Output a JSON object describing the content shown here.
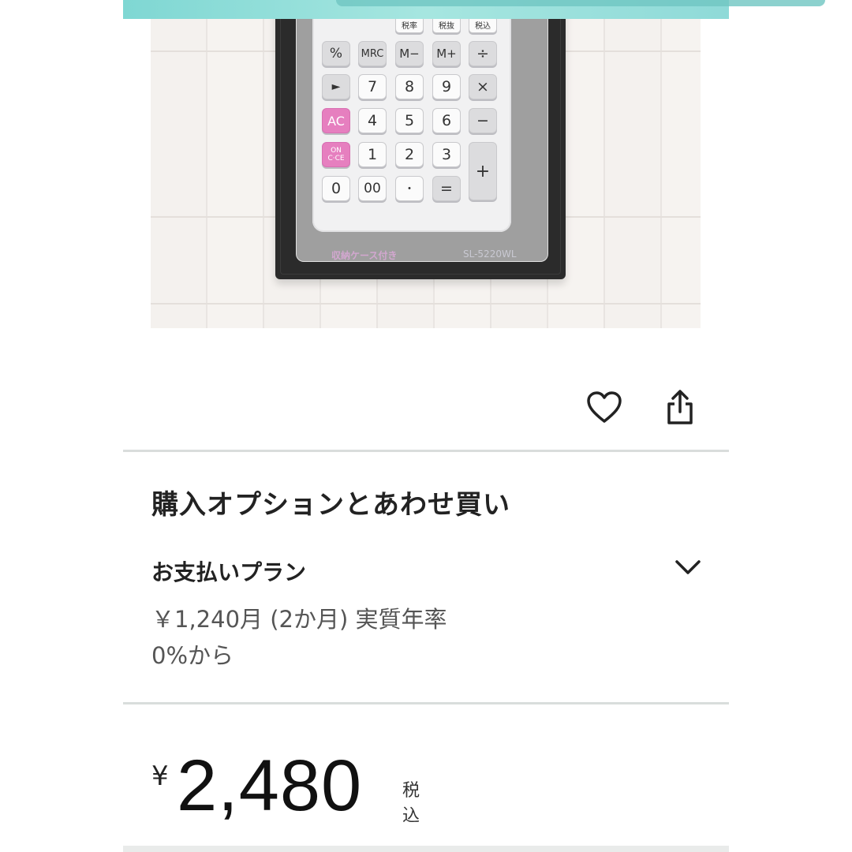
{
  "product_image": {
    "calculator_keys": {
      "tax_keys": [
        "税率",
        "税抜",
        "税込"
      ],
      "row1": [
        "%",
        "MRC",
        "M−",
        "M+",
        "÷"
      ],
      "row2": [
        "►",
        "7",
        "8",
        "9",
        "×"
      ],
      "row3": [
        "AC",
        "4",
        "5",
        "6",
        "−"
      ],
      "row4": [
        "ON C·CE",
        "1",
        "2",
        "3",
        "+"
      ],
      "row5": [
        "0",
        "00",
        "・",
        "="
      ]
    },
    "package_label_left": "収納ケース付き",
    "package_label_right": "SL-5220WL"
  },
  "actions": {
    "like_icon": "heart-outline-icon",
    "share_icon": "share-icon"
  },
  "purchase_options": {
    "title": "購入オプションとあわせ買い",
    "payment_plan": {
      "label": "お支払いプラン",
      "detail_line1": "￥1,240月 (2か月) 実質年率",
      "detail_line2": "0%から",
      "chevron_icon": "chevron-down-icon"
    }
  },
  "price": {
    "currency_symbol": "¥",
    "amount": "2,480",
    "tax_note": "税込"
  },
  "colors": {
    "banner": "#8fdad8",
    "accent_pink": "#e67fbf",
    "divider": "#d9dddc"
  }
}
